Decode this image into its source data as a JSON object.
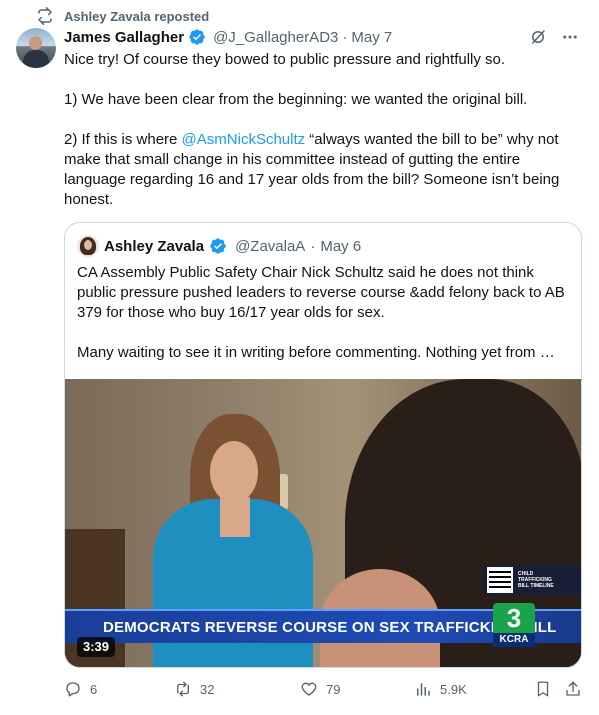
{
  "repost": {
    "icon": "repost-icon",
    "text": "Ashley Zavala reposted"
  },
  "tweet": {
    "author_name": "James Gallagher",
    "handle": "@J_GallagherAD3",
    "separator": "·",
    "date": "May 7",
    "line1": "Nice try! Of course they bowed to public pressure and rightfully so.",
    "line2": "1) We have been clear from the beginning: we wanted the original bill.",
    "line3_prefix": "2) If this is where ",
    "line3_mention": "@AsmNickSchultz",
    "line3_suffix": " “always wanted the bill to be” why not make that small change in his committee instead of gutting the entire language regarding 16 and 17 year olds from the bill? Someone isn’t being honest."
  },
  "quote": {
    "author_name": "Ashley Zavala",
    "handle": "@ZavalaA",
    "separator": "·",
    "date": "May 6",
    "para1": "CA Assembly Public Safety Chair Nick Schultz said he does not think public pressure pushed leaders to reverse course &add felony back to AB 379 for those who buy 16/17 year olds for sex.",
    "para2": "Many waiting to see it in writing before commenting. Nothing yet from …",
    "video": {
      "headline": "DEMOCRATS REVERSE COURSE ON SEX TRAFFICKING BILL",
      "duration": "3:39",
      "qr_caption": "CHILD\nTRAFFICKING\nBILL TIMELINE",
      "station_number": "3",
      "station_call": "KCRA"
    }
  },
  "actions": {
    "replies": "6",
    "reposts": "32",
    "likes": "79",
    "views": "5.9K"
  },
  "colors": {
    "accent": "#1d9bf0",
    "secondary_text": "#536471",
    "border": "#cfd9de",
    "lower_third": "#1e4bb5",
    "kcra_green": "#1aa34a"
  }
}
